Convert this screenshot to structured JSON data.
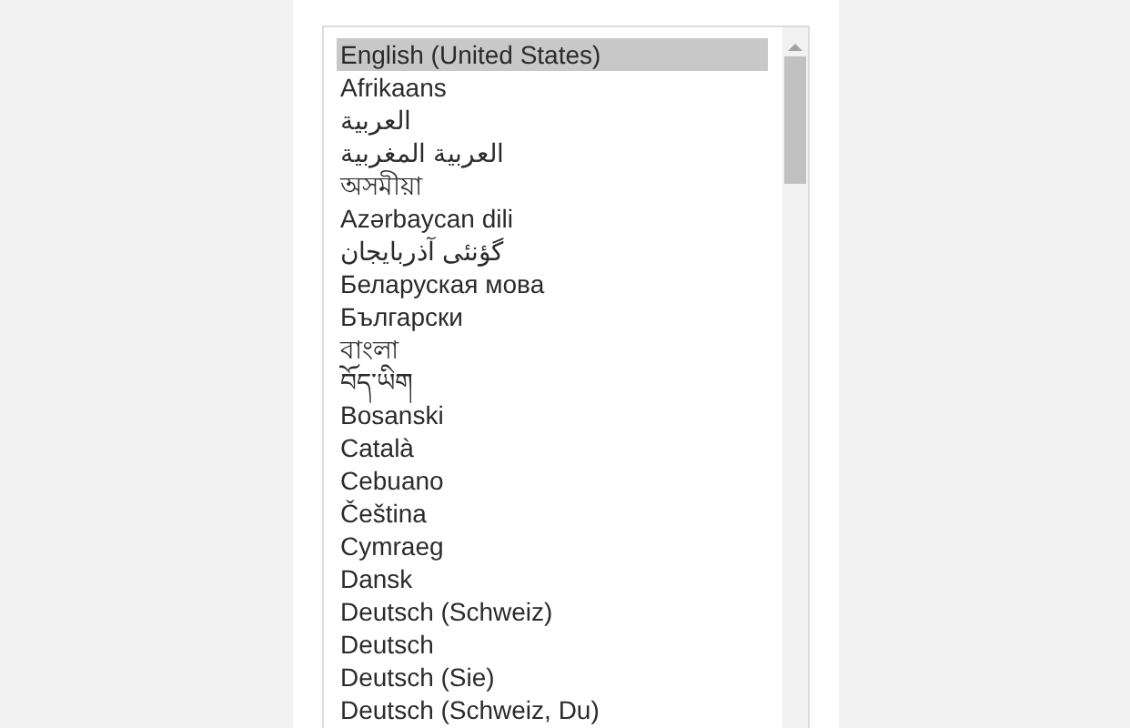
{
  "language_list": {
    "items": [
      {
        "label": "English (United States)",
        "selected": true
      },
      {
        "label": "Afrikaans",
        "selected": false
      },
      {
        "label": "العربية",
        "selected": false
      },
      {
        "label": "العربية المغربية",
        "selected": false
      },
      {
        "label": "অসমীয়া",
        "selected": false
      },
      {
        "label": "Azərbaycan dili",
        "selected": false
      },
      {
        "label": "گؤنئی آذربایجان",
        "selected": false
      },
      {
        "label": "Беларуская мова",
        "selected": false
      },
      {
        "label": "Български",
        "selected": false
      },
      {
        "label": "বাংলা",
        "selected": false
      },
      {
        "label": "བོད་ཡིག",
        "selected": false
      },
      {
        "label": "Bosanski",
        "selected": false
      },
      {
        "label": "Català",
        "selected": false
      },
      {
        "label": "Cebuano",
        "selected": false
      },
      {
        "label": "Čeština",
        "selected": false
      },
      {
        "label": "Cymraeg",
        "selected": false
      },
      {
        "label": "Dansk",
        "selected": false
      },
      {
        "label": "Deutsch (Schweiz)",
        "selected": false
      },
      {
        "label": "Deutsch",
        "selected": false
      },
      {
        "label": "Deutsch (Sie)",
        "selected": false
      },
      {
        "label": "Deutsch (Schweiz, Du)",
        "selected": false
      }
    ]
  }
}
